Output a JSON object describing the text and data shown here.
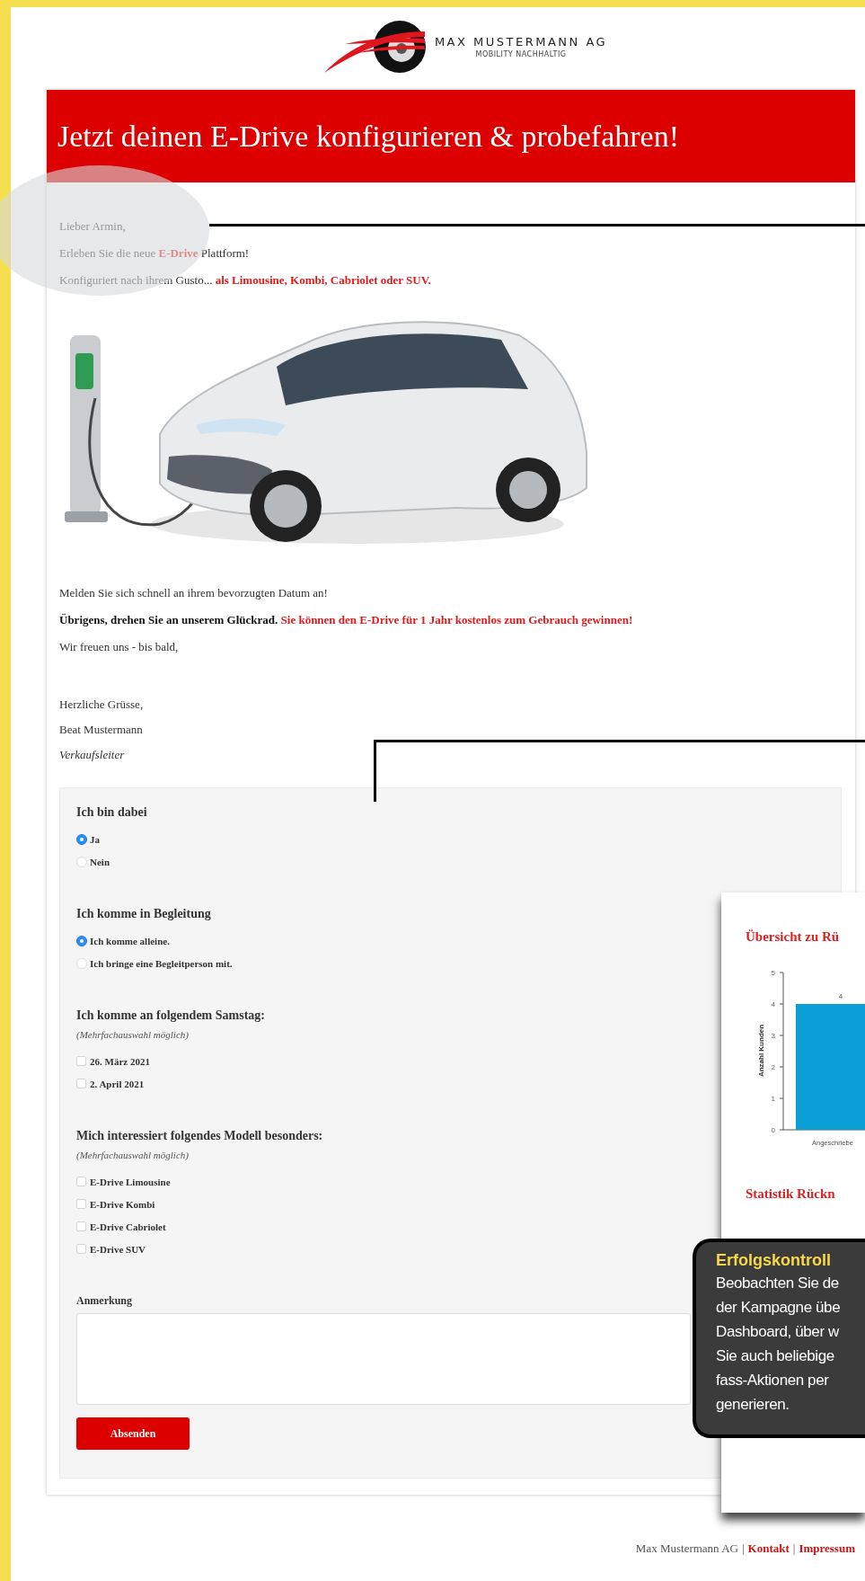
{
  "logo": {
    "name": "MAX MUSTERMANN AG",
    "tagline": "MOBILITY NACHHALTIG"
  },
  "banner": {
    "title": "Jetzt deinen E-Drive konfigurieren & probefahren!"
  },
  "intro": [
    {
      "runs": [
        {
          "text": "Lieber Armin,",
          "kind": "plain"
        }
      ]
    },
    {
      "runs": [
        {
          "text": "Erleben Sie die neue ",
          "kind": "plain"
        },
        {
          "text": "E-Drive",
          "kind": "highlight"
        },
        {
          "text": " Plattform!",
          "kind": "plain"
        }
      ]
    },
    {
      "runs": [
        {
          "text": "Konfiguriert nach ihrem Gusto... ",
          "kind": "plain"
        },
        {
          "text": "als Limousine, Kombi, Cabriolet oder SUV.",
          "kind": "highlight"
        }
      ]
    }
  ],
  "message": [
    {
      "runs": [
        {
          "text": "Melden Sie sich schnell an ihrem bevorzugten Datum an!",
          "kind": "plain"
        }
      ]
    },
    {
      "runs": [
        {
          "text": "Übrigens, drehen Sie an unserem Glückrad. ",
          "kind": "strong"
        },
        {
          "text": "Sie können den E-Drive für 1 Jahr kostenlos zum Gebrauch gewinnen!",
          "kind": "highlight"
        }
      ]
    },
    {
      "runs": [
        {
          "text": "Wir freuen uns - bis bald,",
          "kind": "plain"
        }
      ]
    }
  ],
  "signature": [
    {
      "runs": [
        {
          "text": "Herzliche Grüsse,",
          "kind": "plain"
        }
      ]
    },
    {
      "runs": [
        {
          "text": "Beat Mustermann",
          "kind": "plain"
        }
      ]
    },
    {
      "runs": [
        {
          "text": "Verkaufsleiter",
          "kind": "italic"
        }
      ]
    }
  ],
  "form": {
    "groups": [
      {
        "title": "Ich bin dabei",
        "kind": "radio",
        "options": [
          {
            "label": "Ja",
            "selected": true
          },
          {
            "label": "Nein",
            "selected": false
          }
        ]
      },
      {
        "title": "Ich komme in Begleitung",
        "kind": "radio",
        "options": [
          {
            "label": "Ich komme alleine.",
            "selected": true
          },
          {
            "label": "Ich bringe eine Begleitperson mit.",
            "selected": false
          }
        ]
      },
      {
        "title": "Ich komme an folgendem Samstag:",
        "hint": "(Mehrfachauswahl möglich)",
        "kind": "checkbox",
        "options": [
          {
            "label": "26. März 2021",
            "checked": false
          },
          {
            "label": "2. April 2021",
            "checked": false
          }
        ]
      },
      {
        "title": "Mich interessiert folgendes Modell besonders:",
        "hint": "(Mehrfachauswahl möglich)",
        "kind": "checkbox",
        "options": [
          {
            "label": "E-Drive Limousine",
            "checked": false
          },
          {
            "label": "E-Drive Kombi",
            "checked": false
          },
          {
            "label": "E-Drive Cabriolet",
            "checked": false
          },
          {
            "label": "E-Drive SUV",
            "checked": false
          }
        ]
      }
    ],
    "remark": {
      "label": "Anmerkung"
    },
    "submit": "Absenden"
  },
  "report_window": {
    "heading": "Übersicht zu Rü",
    "chart_data": {
      "type": "bar",
      "ylabel": "Anzahl Kunden",
      "categories": [
        "Angeschriebe"
      ],
      "values": [
        4
      ],
      "ylim": [
        0,
        5
      ],
      "yticks": [
        0,
        1,
        2,
        3,
        4,
        5
      ],
      "data_labels": true
    },
    "subheading": "Statistik Rückn"
  },
  "callout": {
    "title": "Erfolgskontroll",
    "lines": [
      "Beobachten Sie de",
      "der Kampagne übe",
      "Dashboard, über w",
      "Sie auch beliebige",
      "fass-Aktionen per",
      "generieren."
    ]
  },
  "footer": [
    {
      "text": "Max Mustermann AG",
      "kind": "plain"
    },
    {
      "text": "|",
      "kind": "separator"
    },
    {
      "text": "Kontakt",
      "kind": "link"
    },
    {
      "text": "|",
      "kind": "separator"
    },
    {
      "text": "Impressum",
      "kind": "link"
    }
  ]
}
